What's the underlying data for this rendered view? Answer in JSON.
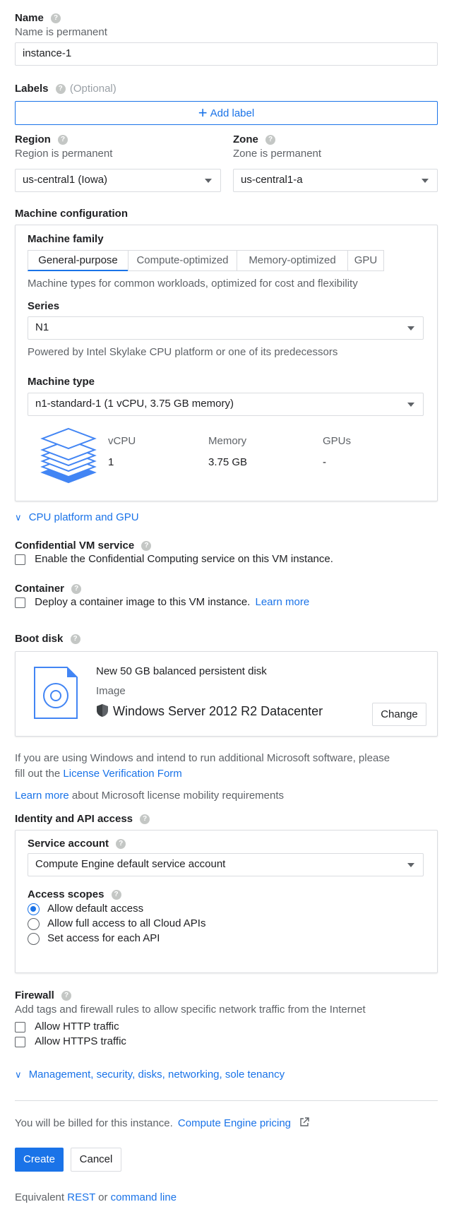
{
  "name": {
    "label": "Name",
    "hint": "Name is permanent",
    "value": "instance-1"
  },
  "labels": {
    "label": "Labels",
    "optional": "(Optional)",
    "add_button": "Add label"
  },
  "region": {
    "label": "Region",
    "hint": "Region is permanent",
    "value": "us-central1 (Iowa)"
  },
  "zone": {
    "label": "Zone",
    "hint": "Zone is permanent",
    "value": "us-central1-a"
  },
  "machine_config": {
    "title": "Machine configuration",
    "family_label": "Machine family",
    "tabs": [
      "General-purpose",
      "Compute-optimized",
      "Memory-optimized",
      "GPU"
    ],
    "family_desc": "Machine types for common workloads, optimized for cost and flexibility",
    "series_label": "Series",
    "series_value": "N1",
    "series_desc": "Powered by Intel Skylake CPU platform or one of its predecessors",
    "type_label": "Machine type",
    "type_value": "n1-standard-1 (1 vCPU, 3.75 GB memory)",
    "spec_headers": [
      "vCPU",
      "Memory",
      "GPUs"
    ],
    "spec_values": [
      "1",
      "3.75 GB",
      "-"
    ]
  },
  "cpu_platform_link": "CPU platform and GPU",
  "confidential": {
    "title": "Confidential VM service",
    "checkbox_label": "Enable the Confidential Computing service on this VM instance."
  },
  "container": {
    "title": "Container",
    "checkbox_label": "Deploy a container image to this VM instance.",
    "learn_more": "Learn more"
  },
  "boot_disk": {
    "title": "Boot disk",
    "disk_name": "New 50 GB balanced persistent disk",
    "image_label": "Image",
    "image_value": "Windows Server 2012 R2 Datacenter",
    "change_button": "Change"
  },
  "license": {
    "text_1": "If you are using Windows and intend to run additional Microsoft software, please",
    "text_2": "fill out the",
    "form_link": "License Verification Form",
    "learn_more": "Learn more",
    "mobility_text": "about Microsoft license mobility requirements"
  },
  "identity": {
    "title": "Identity and API access",
    "service_account_label": "Service account",
    "service_account_value": "Compute Engine default service account",
    "scopes_label": "Access scopes",
    "scopes": [
      "Allow default access",
      "Allow full access to all Cloud APIs",
      "Set access for each API"
    ],
    "selected_scope": "Allow default access"
  },
  "firewall": {
    "title": "Firewall",
    "desc": "Add tags and firewall rules to allow specific network traffic from the Internet",
    "http": "Allow HTTP traffic",
    "https": "Allow HTTPS traffic"
  },
  "management_link": "Management, security, disks, networking, sole tenancy",
  "billing": {
    "text": "You will be billed for this instance.",
    "pricing_link": "Compute Engine pricing"
  },
  "actions": {
    "create": "Create",
    "cancel": "Cancel"
  },
  "equivalent": {
    "text": "Equivalent",
    "rest": "REST",
    "or": "or",
    "command_line": "command line"
  },
  "colors": {
    "accent": "#1a73e8",
    "text": "#202124",
    "muted": "#5f6368",
    "border": "#dadce0"
  }
}
